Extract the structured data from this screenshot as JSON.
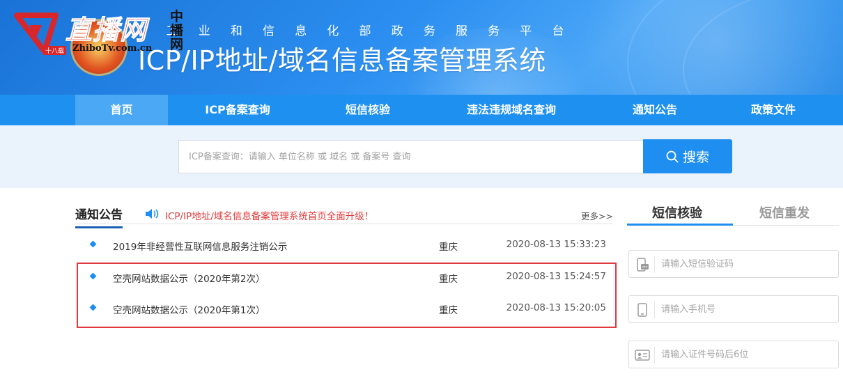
{
  "banner": {
    "subtitle_chars": [
      "工",
      "业",
      "和",
      "信",
      "息",
      "化",
      "部",
      "政",
      "务",
      "服",
      "务",
      "平",
      "台"
    ],
    "title": "ICP/IP地址/域名信息备案管理系统"
  },
  "watermark": {
    "brand": "直播网",
    "side": "中播网",
    "url": "ZhiboTv.com.cn",
    "tag": "十八载"
  },
  "nav": {
    "items": [
      {
        "label": "首页"
      },
      {
        "label": "ICP备案查询"
      },
      {
        "label": "短信核验"
      },
      {
        "label": "违法违规域名查询"
      },
      {
        "label": "通知公告"
      },
      {
        "label": "政策文件"
      }
    ]
  },
  "search": {
    "placeholder": "ICP备案查询：请输入 单位名称 或 域名 或 备案号 查询",
    "button_label": "搜索"
  },
  "notice": {
    "title": "通知公告",
    "marquee": "ICP/IP地址/域名信息备案管理系统首页全面升级！",
    "more": "更多>>",
    "rows": [
      {
        "title": "2019年非经营性互联网信息服务注销公示",
        "region": "重庆",
        "time": "2020-08-13 15:33:23"
      },
      {
        "title": "空壳网站数据公示（2020年第2次）",
        "region": "重庆",
        "time": "2020-08-13 15:24:57"
      },
      {
        "title": "空壳网站数据公示（2020年第1次）",
        "region": "重庆",
        "time": "2020-08-13 15:20:05"
      }
    ]
  },
  "sms_panel": {
    "tabs": [
      {
        "label": "短信核验"
      },
      {
        "label": "短信重发"
      }
    ],
    "fields": [
      {
        "placeholder": "请输入短信验证码",
        "icon": "sms-icon"
      },
      {
        "placeholder": "请输入手机号",
        "icon": "phone-icon"
      },
      {
        "placeholder": "请输入证件号码后6位",
        "icon": "id-card-icon"
      }
    ]
  },
  "colors": {
    "nav_bg": "#1e90f0",
    "nav_active": "#4aa8f5",
    "accent": "#1e8ff0",
    "alert_red": "#e03a3a",
    "highlight_border": "#e0393e"
  }
}
